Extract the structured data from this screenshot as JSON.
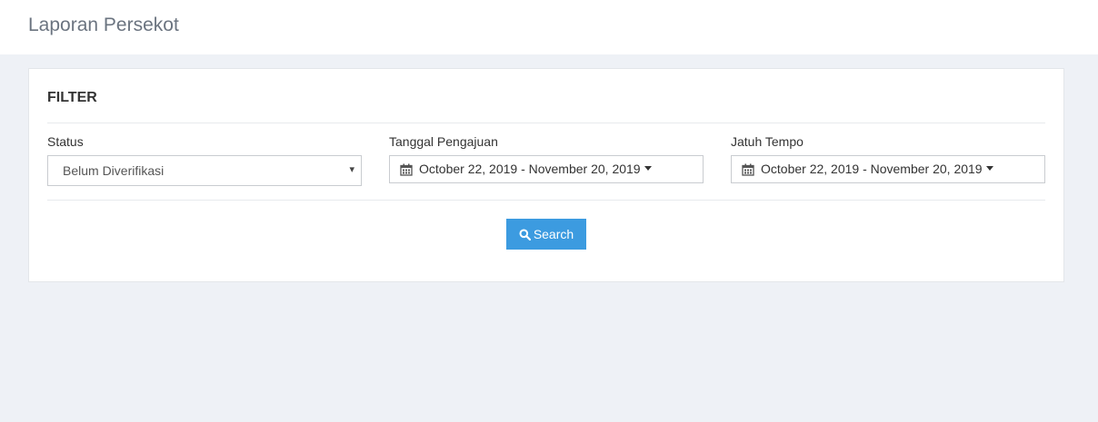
{
  "header": {
    "title": "Laporan Persekot"
  },
  "filter": {
    "title": "FILTER",
    "status": {
      "label": "Status",
      "value": "Belum Diverifikasi",
      "caret": "▾"
    },
    "tanggal_pengajuan": {
      "label": "Tanggal Pengajuan",
      "value": "October 22, 2019 - November 20, 2019"
    },
    "jatuh_tempo": {
      "label": "Jatuh Tempo",
      "value": "October 22, 2019 - November 20, 2019"
    },
    "search_label": "Search"
  },
  "colors": {
    "page_bg": "#eef1f6",
    "button": "#3c9be0",
    "title": "#6b7480"
  },
  "icons": [
    "calendar-icon",
    "search-icon",
    "caret-down-icon"
  ]
}
